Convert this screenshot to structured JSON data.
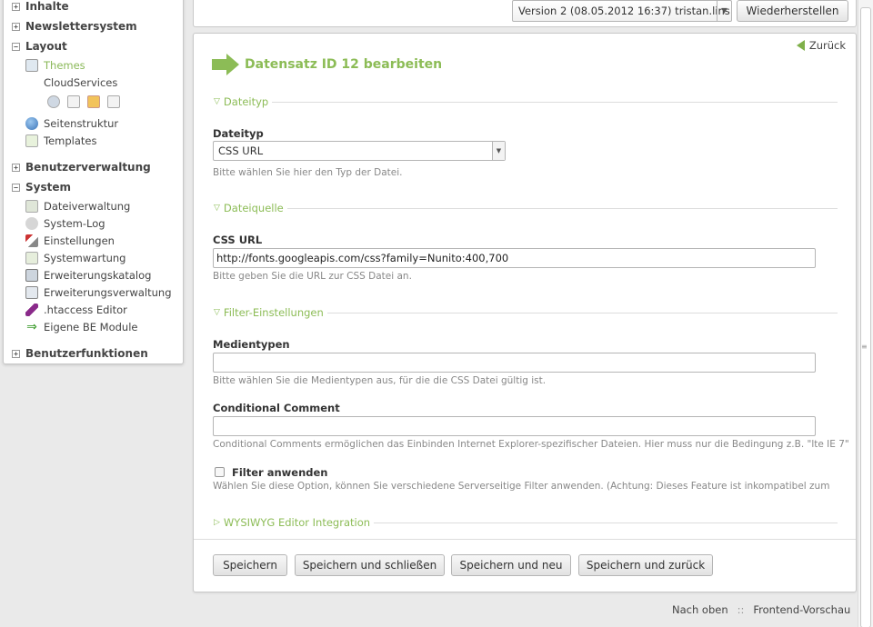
{
  "sidebar": {
    "groups": [
      {
        "toggle": "+",
        "label": "Inhalte"
      },
      {
        "toggle": "+",
        "label": "Newslettersystem"
      },
      {
        "toggle": "−",
        "label": "Layout"
      },
      {
        "toggle": "+",
        "label": "Benutzerverwaltung"
      },
      {
        "toggle": "−",
        "label": "System"
      },
      {
        "toggle": "+",
        "label": "Benutzerfunktionen"
      }
    ],
    "layout_items": [
      {
        "label": "Themes",
        "icon": "themes-icon"
      },
      {
        "label": "CloudServices",
        "icon": ""
      },
      {
        "label": "Seitenstruktur",
        "icon": "globe-icon"
      },
      {
        "label": "Templates",
        "icon": "templates-icon"
      }
    ],
    "system_items": [
      {
        "label": "Dateiverwaltung",
        "icon": "folder-icon"
      },
      {
        "label": "System-Log",
        "icon": "log-icon"
      },
      {
        "label": "Einstellungen",
        "icon": "tools-icon"
      },
      {
        "label": "Systemwartung",
        "icon": "maintenance-icon"
      },
      {
        "label": "Erweiterungskatalog",
        "icon": "catalog-icon"
      },
      {
        "label": "Erweiterungsverwaltung",
        "icon": "extension-manager-icon"
      },
      {
        "label": ".htaccess Editor",
        "icon": "feather-icon"
      },
      {
        "label": "Eigene BE Module",
        "icon": "green-arrow-icon"
      }
    ],
    "active": "Themes"
  },
  "topbar": {
    "version": "Version 2 (08.05.2012 16:37) tristan.lins",
    "restore_label": "Wiederherstellen"
  },
  "panel": {
    "back_label": "Zurück",
    "title": "Datensatz ID 12 bearbeiten",
    "sections": {
      "dateityp": "Dateityp",
      "dateiquelle": "Dateiquelle",
      "filter": "Filter-Einstellungen",
      "wysiwyg": "WYSIWYG Editor Integration"
    },
    "fields": {
      "dateityp_label": "Dateityp",
      "dateityp_value": "CSS URL",
      "dateityp_hint": "Bitte wählen Sie hier den Typ der Datei.",
      "cssurl_label": "CSS URL",
      "cssurl_value": "http://fonts.googleapis.com/css?family=Nunito:400,700",
      "cssurl_hint": "Bitte geben Sie die URL zur CSS Datei an.",
      "medientypen_label": "Medientypen",
      "medientypen_value": "",
      "medientypen_hint": "Bitte wählen Sie die Medientypen aus, für die die CSS Datei gültig ist.",
      "cc_label": "Conditional Comment",
      "cc_value": "",
      "cc_hint": "Conditional Comments ermöglichen das Einbinden Internet Explorer-spezifischer Dateien. Hier muss nur die Bedingung z.B. \"lte IE 7\"",
      "filter_label": "Filter anwenden",
      "filter_checked": false,
      "filter_hint": "Wählen Sie diese Option, können Sie verschiedene Serverseitige Filter anwenden. (Achtung: Dieses Feature ist inkompatibel zum"
    },
    "buttons": {
      "save": "Speichern",
      "save_close": "Speichern und schließen",
      "save_new": "Speichern und neu",
      "save_back": "Speichern und zurück"
    }
  },
  "footer": {
    "top_link": "Nach oben",
    "separator": "::",
    "preview_link": "Frontend-Vorschau"
  },
  "colors": {
    "accent": "#8cbc56",
    "background": "#eaeaea"
  }
}
